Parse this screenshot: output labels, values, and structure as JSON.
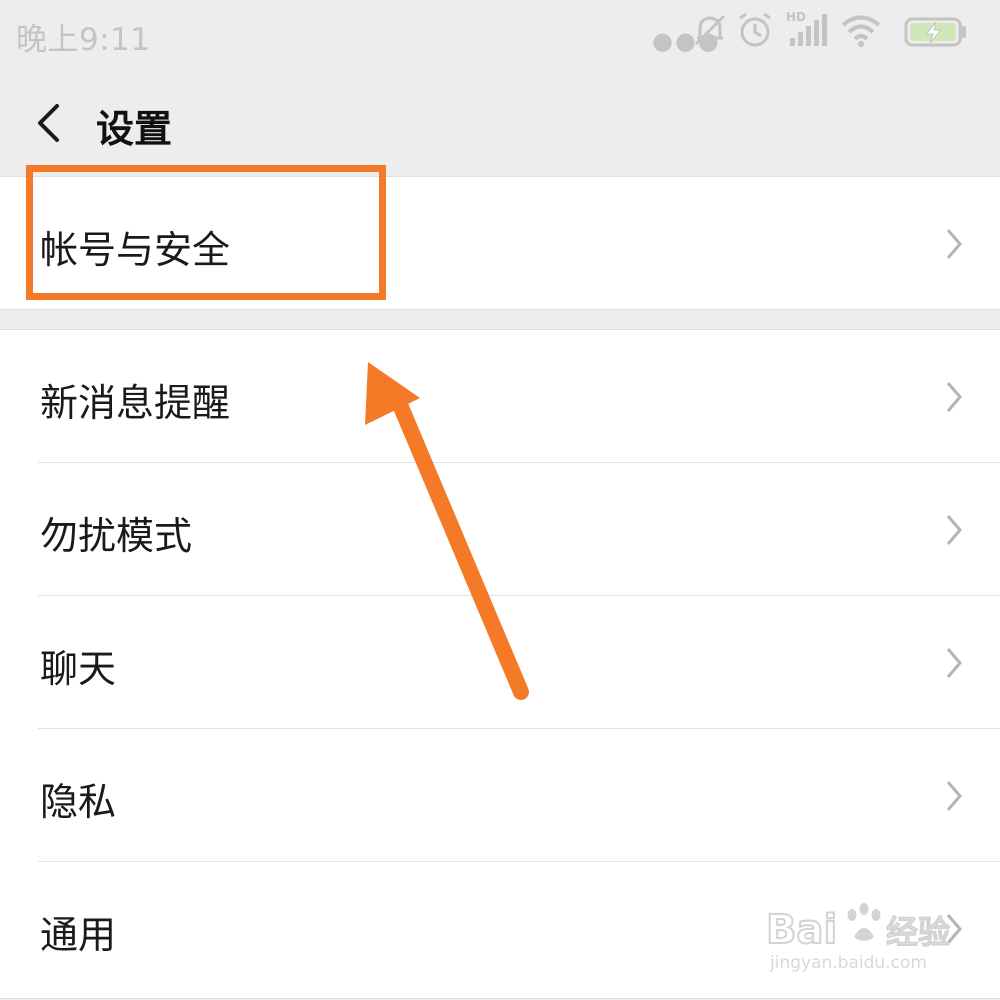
{
  "status_bar": {
    "time": "晚上9:11",
    "icons": [
      "more-dots-icon",
      "silent-bell-icon",
      "alarm-icon",
      "hd-signal-icon",
      "wifi-icon",
      "battery-charging-icon"
    ],
    "signal_label": "HD"
  },
  "header": {
    "title": "设置",
    "back_icon": "chevron-left-icon"
  },
  "settings": {
    "items": [
      {
        "label": "帐号与安全"
      },
      {
        "label": "新消息提醒"
      },
      {
        "label": "勿扰模式"
      },
      {
        "label": "聊天"
      },
      {
        "label": "隐私"
      },
      {
        "label": "通用"
      }
    ]
  },
  "annotation": {
    "color": "#f47a28"
  },
  "watermark": {
    "brand": "Bai",
    "brand2": "du",
    "suffix": "经验",
    "url": "jingyan.baidu.com"
  }
}
